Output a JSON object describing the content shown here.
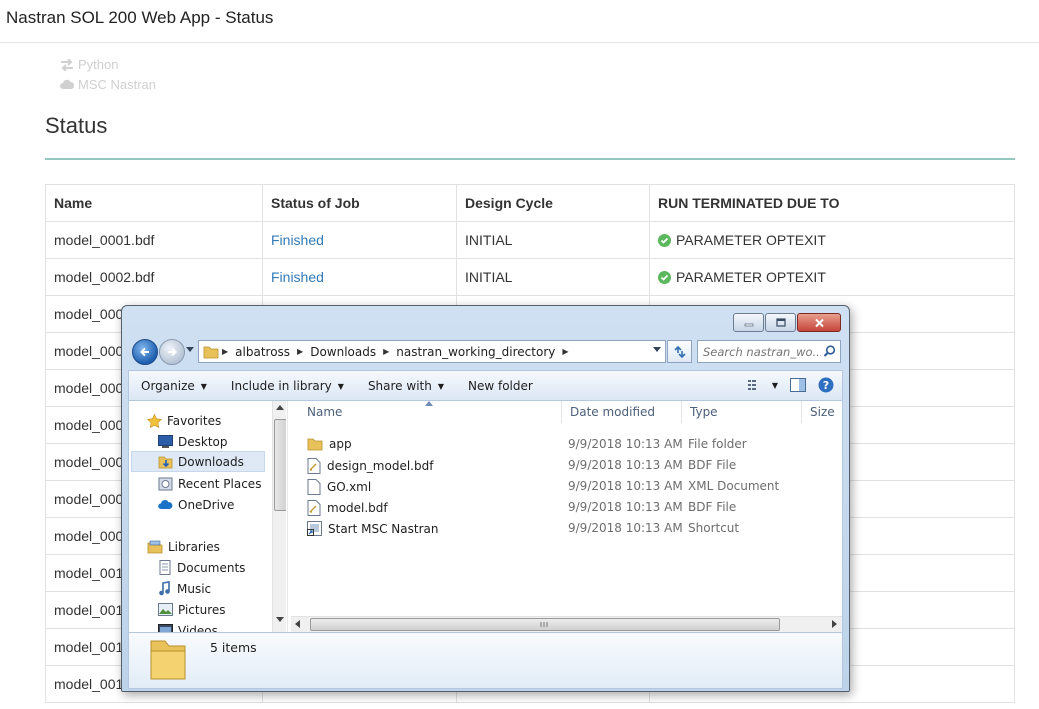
{
  "app": {
    "title": "Nastran SOL 200 Web App - Status",
    "nav": [
      "Python",
      "MSC Nastran"
    ],
    "heading": "Status"
  },
  "table": {
    "headers": [
      "Name",
      "Status of Job",
      "Design Cycle",
      "RUN TERMINATED DUE TO"
    ],
    "rows": [
      {
        "name": "model_0001.bdf",
        "status": "Finished",
        "cycle": "INITIAL",
        "term": "PARAMETER OPTEXIT"
      },
      {
        "name": "model_0002.bdf",
        "status": "Finished",
        "cycle": "INITIAL",
        "term": "PARAMETER OPTEXIT"
      },
      {
        "name": "model_000",
        "status": "",
        "cycle": "",
        "term": ""
      },
      {
        "name": "model_000",
        "status": "",
        "cycle": "",
        "term": ""
      },
      {
        "name": "model_000",
        "status": "",
        "cycle": "",
        "term": ""
      },
      {
        "name": "model_000",
        "status": "",
        "cycle": "",
        "term": ""
      },
      {
        "name": "model_000",
        "status": "",
        "cycle": "",
        "term": ""
      },
      {
        "name": "model_000",
        "status": "",
        "cycle": "",
        "term": ""
      },
      {
        "name": "model_000",
        "status": "",
        "cycle": "",
        "term": ""
      },
      {
        "name": "model_001",
        "status": "",
        "cycle": "",
        "term": ""
      },
      {
        "name": "model_001",
        "status": "",
        "cycle": "",
        "term": ""
      },
      {
        "name": "model_001",
        "status": "",
        "cycle": "",
        "term": ""
      },
      {
        "name": "model_001",
        "status": "",
        "cycle": "",
        "term": ""
      }
    ]
  },
  "explorer": {
    "breadcrumb": [
      "albatross",
      "Downloads",
      "nastran_working_directory"
    ],
    "search_placeholder": "Search nastran_wo...",
    "toolbar": {
      "organize": "Organize",
      "include": "Include in library",
      "share": "Share with",
      "new_folder": "New folder"
    },
    "nav": {
      "favorites": "Favorites",
      "desktop": "Desktop",
      "downloads": "Downloads",
      "recent": "Recent Places",
      "onedrive": "OneDrive",
      "libraries": "Libraries",
      "documents": "Documents",
      "music": "Music",
      "pictures": "Pictures",
      "videos": "Videos"
    },
    "columns": [
      "Name",
      "Date modified",
      "Type",
      "Size"
    ],
    "files": [
      {
        "name": "app",
        "date": "9/9/2018 10:13 AM",
        "type": "File folder",
        "icon": "folder-icon"
      },
      {
        "name": "design_model.bdf",
        "date": "9/9/2018 10:13 AM",
        "type": "BDF File",
        "icon": "bdf-file-icon"
      },
      {
        "name": "GO.xml",
        "date": "9/9/2018 10:13 AM",
        "type": "XML Document",
        "icon": "xml-file-icon"
      },
      {
        "name": "model.bdf",
        "date": "9/9/2018 10:13 AM",
        "type": "BDF File",
        "icon": "bdf-file-icon"
      },
      {
        "name": "Start MSC Nastran",
        "date": "9/9/2018 10:13 AM",
        "type": "Shortcut",
        "icon": "shortcut-icon"
      }
    ],
    "status": "5 items",
    "colors": {
      "folder": "#e8c15a",
      "selection": "#dfe9f5",
      "link": "#337ab7",
      "accent_rule": "#93c7c0",
      "check": "#5cb85c"
    }
  }
}
